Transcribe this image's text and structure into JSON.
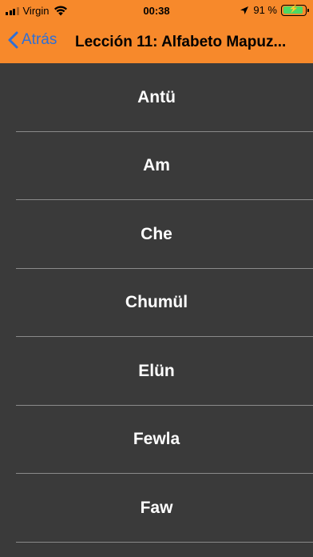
{
  "status_bar": {
    "carrier": "Virgin",
    "time": "00:38",
    "battery_percent": "91 %",
    "battery_level": 0.91
  },
  "nav": {
    "back_label": "Atrás",
    "title": "Lección 11: Alfabeto Mapuz..."
  },
  "items": [
    {
      "label": "Antü"
    },
    {
      "label": "Am"
    },
    {
      "label": "Che"
    },
    {
      "label": "Chumül"
    },
    {
      "label": "Elün"
    },
    {
      "label": "Fewla"
    },
    {
      "label": "Faw"
    }
  ],
  "colors": {
    "header": "#f7892b",
    "background": "#3a3a3a",
    "back_link": "#2f6fd6",
    "battery_fill": "#4cd964"
  }
}
